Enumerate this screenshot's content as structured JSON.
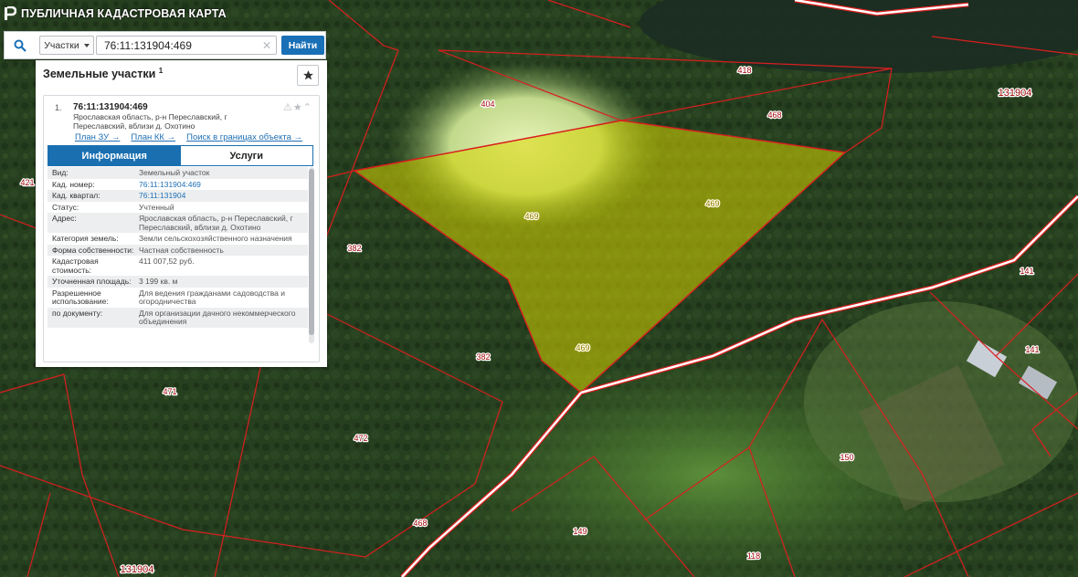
{
  "header": {
    "title": "ПУБЛИЧНАЯ КАДАСТРОВАЯ КАРТА"
  },
  "search": {
    "type_label": "Участки",
    "query": "76:11:131904:469",
    "button_label": "Найти"
  },
  "panel": {
    "title": "Земельные участки",
    "count": "1",
    "result": {
      "index": "1.",
      "cad_number": "76:11:131904:469",
      "address": "Ярославская область, р-н Переславский, г Переславский, вблизи д. Охотино",
      "links": [
        "План ЗУ →",
        "План КК →",
        "Поиск в границах объекта →"
      ]
    },
    "tabs": [
      {
        "label": "Информация",
        "active": true
      },
      {
        "label": "Услуги",
        "active": false
      }
    ],
    "info_rows": [
      {
        "label": "Вид:",
        "value": "Земельный участок"
      },
      {
        "label": "Кад. номер:",
        "value": "76:11:131904:469",
        "link": true
      },
      {
        "label": "Кад. квартал:",
        "value": "76:11:131904",
        "link": true
      },
      {
        "label": "Статус:",
        "value": "Учтенный"
      },
      {
        "label": "Адрес:",
        "value": "Ярославская область, р-н Переславский, г Переславский, вблизи д. Охотино"
      },
      {
        "label": "Категория земель:",
        "value": "Земли сельскохозяйственного назначения"
      },
      {
        "label": "Форма собственности:",
        "value": "Частная собственность"
      },
      {
        "label": "Кадастровая стоимость:",
        "value": "411 007,52 руб."
      },
      {
        "label": "Уточненная площадь:",
        "value": "3 199 кв. м"
      },
      {
        "label": "Разрешенное использование:",
        "value": "Для ведения гражданами садоводства и огородничества"
      },
      {
        "label": "по документу:",
        "value": "Для организации дачного некоммерческого объединения"
      }
    ]
  },
  "map": {
    "parcel_labels": [
      "404",
      "418",
      "468",
      "469",
      "469",
      "469",
      "382",
      "382",
      "421",
      "471",
      "472",
      "141",
      "141",
      "150",
      "149",
      "118",
      "468"
    ],
    "quarter_labels": [
      "131904",
      "131904"
    ],
    "colors": {
      "boundary": "#d91f1f",
      "selected_fill": "#d6d400",
      "road": "#ffffff"
    }
  }
}
